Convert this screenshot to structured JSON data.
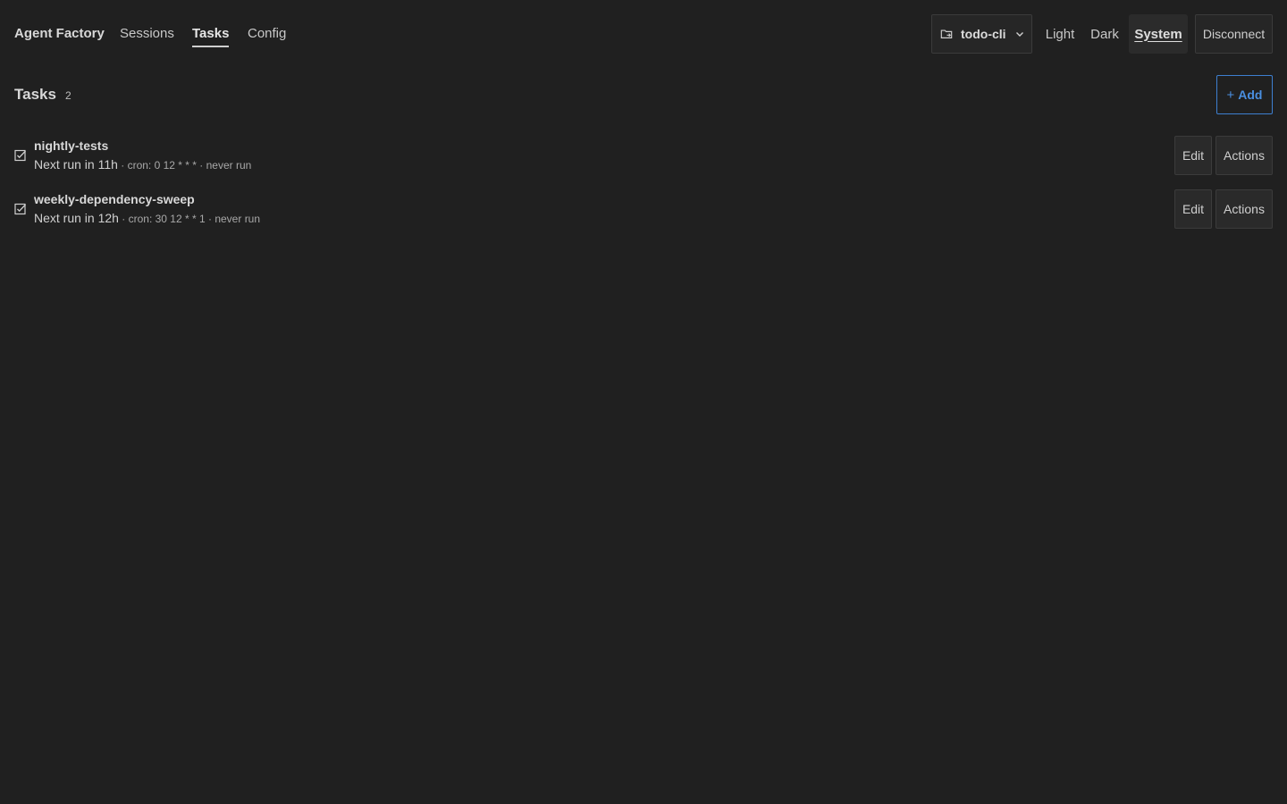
{
  "nav": {
    "brand": "Agent Factory",
    "tabs": [
      {
        "label": "Sessions",
        "active": false
      },
      {
        "label": "Tasks",
        "active": true
      },
      {
        "label": "Config",
        "active": false
      }
    ]
  },
  "project": {
    "name": "todo-cli"
  },
  "theme": {
    "options": [
      {
        "label": "Light",
        "active": false
      },
      {
        "label": "Dark",
        "active": false
      },
      {
        "label": "System",
        "active": true
      }
    ]
  },
  "disconnect_label": "Disconnect",
  "tasks_section": {
    "title": "Tasks",
    "count": "2",
    "add_label": "Add",
    "items": [
      {
        "name": "nightly-tests",
        "next_run": "Next run in 11h",
        "detail": " · cron: 0 12 * * * · never run",
        "edit_label": "Edit",
        "actions_label": "Actions"
      },
      {
        "name": "weekly-dependency-sweep",
        "next_run": "Next run in 12h",
        "detail": " · cron: 30 12 * * 1 · never run",
        "edit_label": "Edit",
        "actions_label": "Actions"
      }
    ]
  },
  "colors": {
    "background": "#202020",
    "accent": "#4a8fe0"
  }
}
